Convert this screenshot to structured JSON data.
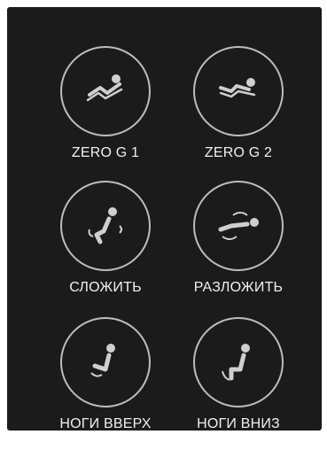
{
  "buttons": [
    {
      "id": "zero-g-1",
      "label": "ZERO G 1",
      "icon": "zero-g-1-icon"
    },
    {
      "id": "zero-g-2",
      "label": "ZERO G 2",
      "icon": "zero-g-2-icon"
    },
    {
      "id": "fold",
      "label": "СЛОЖИТЬ",
      "icon": "fold-icon"
    },
    {
      "id": "unfold",
      "label": "РАЗЛОЖИТЬ",
      "icon": "unfold-icon"
    },
    {
      "id": "legs-up",
      "label": "НОГИ ВВЕРХ",
      "icon": "legs-up-icon"
    },
    {
      "id": "legs-down",
      "label": "НОГИ ВНИЗ",
      "icon": "legs-down-icon"
    }
  ],
  "colors": {
    "panel_background": "#1b1b1b",
    "circle_border": "#bdbdbd",
    "icon_fill": "#cfcfcf",
    "label_text": "#f0f0f0"
  }
}
